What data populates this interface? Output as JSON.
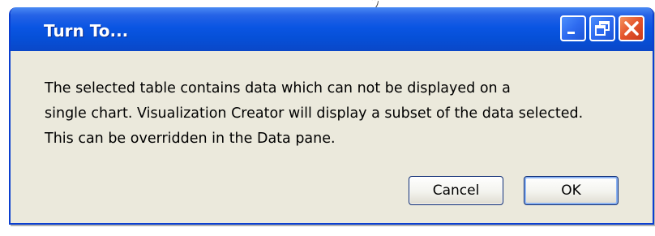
{
  "dialog": {
    "title": "Turn To...",
    "message_lines": [
      "The selected table contains data which can not be displayed on a",
      "single chart. Visualization Creator will display a subset of the data selected.",
      "This can be overridden in the Data pane."
    ],
    "cancel_label": "Cancel",
    "ok_label": "OK"
  },
  "titlebar_buttons": {
    "minimize_icon": "minimize-icon",
    "restore_icon": "restore-icon",
    "close_icon": "close-icon"
  },
  "colors": {
    "titlebar": "#0a55e3",
    "dialog_background": "#ebe9dc",
    "close_button": "#e4532b"
  }
}
